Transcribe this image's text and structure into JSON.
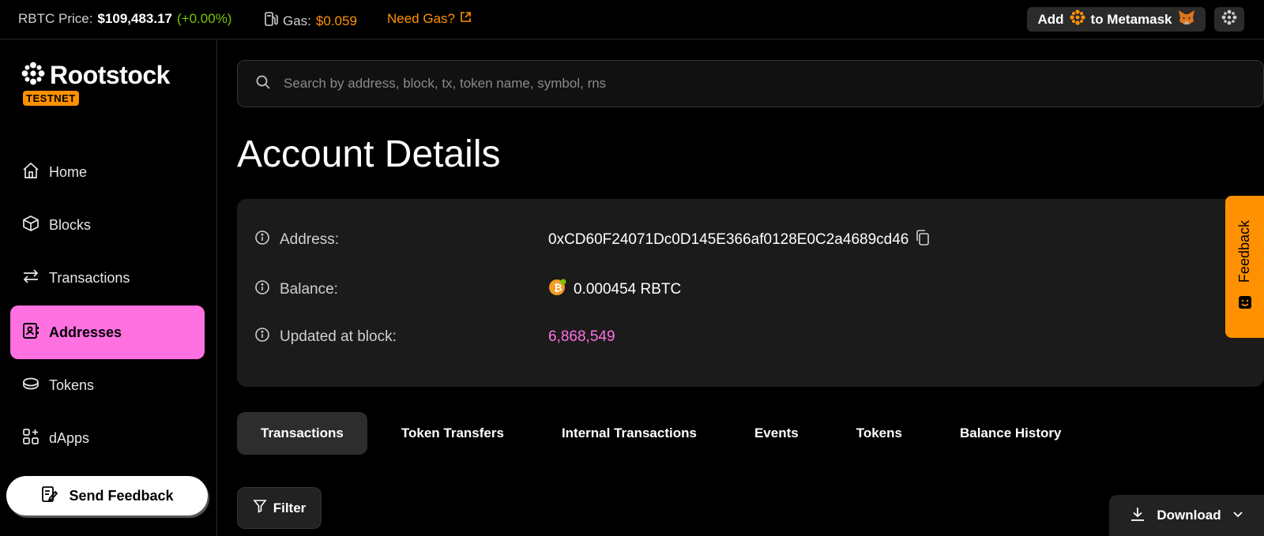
{
  "topbar": {
    "price_label": "RBTC Price:",
    "price_value": "$109,483.17",
    "price_change": "(+0.00%)",
    "gas_label": "Gas:",
    "gas_value": "$0.059",
    "need_gas": "Need Gas?",
    "metamask_add": "Add",
    "metamask_to": "to Metamask"
  },
  "sidebar": {
    "logo_text": "Rootstock",
    "network_badge": "TESTNET",
    "items": [
      {
        "label": "Home",
        "icon": "home-icon"
      },
      {
        "label": "Blocks",
        "icon": "cube-icon"
      },
      {
        "label": "Transactions",
        "icon": "arrows-icon"
      },
      {
        "label": "Addresses",
        "icon": "contact-icon",
        "active": true
      },
      {
        "label": "Tokens",
        "icon": "coin-icon"
      },
      {
        "label": "dApps",
        "icon": "apps-icon"
      }
    ],
    "send_feedback": "Send Feedback"
  },
  "search": {
    "placeholder": "Search by address, block, tx, token name, symbol, rns"
  },
  "page": {
    "title": "Account Details"
  },
  "details": {
    "address_label": "Address:",
    "address_value": "0xCD60F24071Dc0D145E366af0128E0C2a4689cd46",
    "balance_label": "Balance:",
    "balance_value": "0.000454 RBTC",
    "block_label": "Updated at block:",
    "block_value": "6,868,549"
  },
  "tabs": [
    {
      "label": "Transactions",
      "active": true
    },
    {
      "label": "Token Transfers"
    },
    {
      "label": "Internal Transactions"
    },
    {
      "label": "Events"
    },
    {
      "label": "Tokens"
    },
    {
      "label": "Balance History"
    }
  ],
  "actions": {
    "filter": "Filter",
    "download": "Download"
  },
  "feedback_tab": "Feedback",
  "colors": {
    "accent_pink": "#ff71e1",
    "accent_orange": "#ff9100",
    "positive_green": "#79c600"
  }
}
